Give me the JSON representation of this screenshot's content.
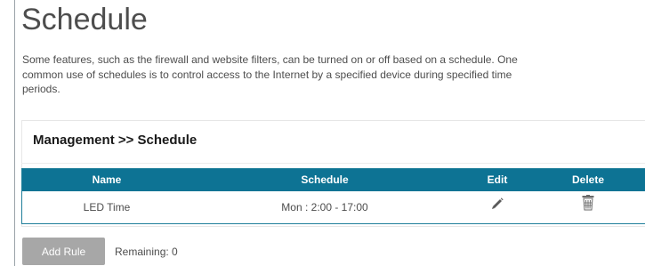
{
  "page": {
    "title": "Schedule",
    "description": "Some features, such as the firewall and website filters, can be turned on or off based on a schedule. One common use of schedules is to control access to the Internet by a specified device during specified time periods."
  },
  "panel": {
    "heading": "Management >> Schedule"
  },
  "table": {
    "columns": {
      "name": "Name",
      "schedule": "Schedule",
      "edit": "Edit",
      "delete": "Delete"
    },
    "rows": [
      {
        "name": "LED Time",
        "schedule": "Mon : 2:00 - 17:00",
        "edit_icon": "pencil-icon",
        "delete_icon": "trash-icon"
      }
    ]
  },
  "footer": {
    "add_rule_label": "Add Rule",
    "remaining_label": "Remaining: 0"
  },
  "colors": {
    "header_bg": "#0d7394",
    "button_bg": "#a7a7a7"
  }
}
